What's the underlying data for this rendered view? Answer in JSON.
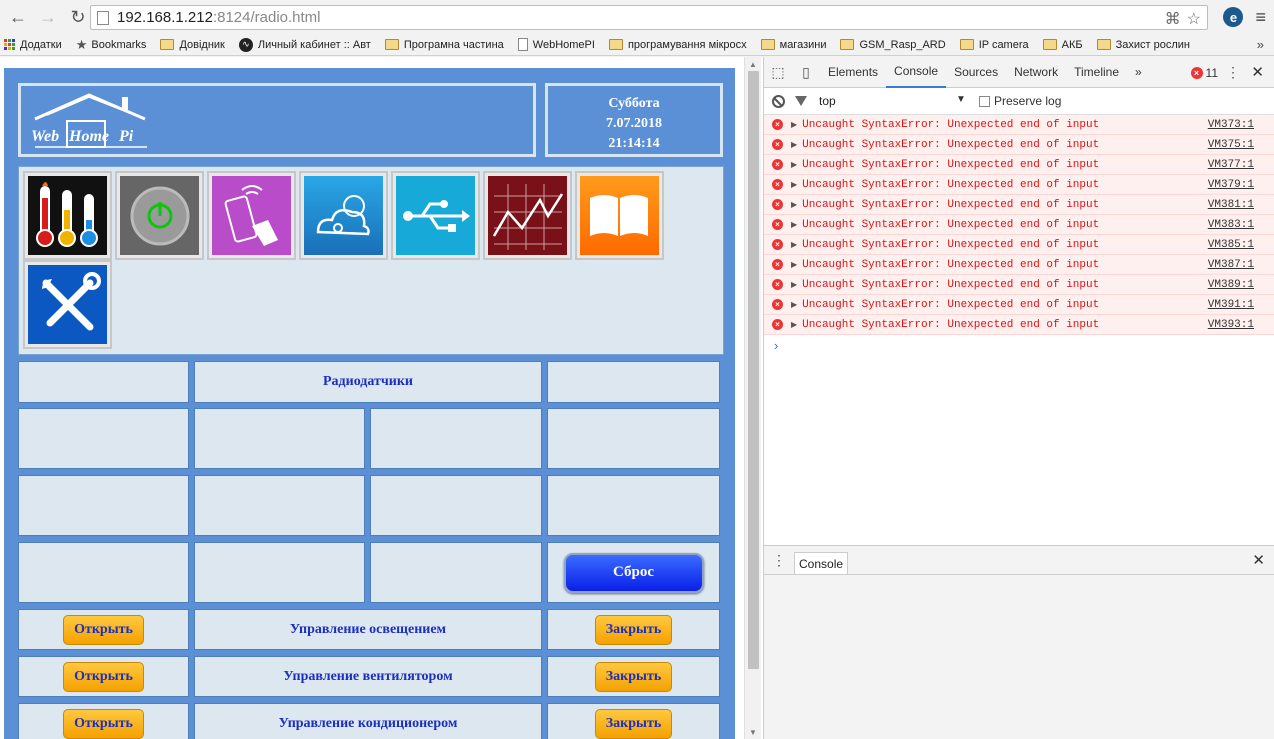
{
  "browser": {
    "url_host": "192.168.1.212",
    "url_rest": ":8124/radio.html",
    "back_glyph": "←",
    "forward_glyph": "→",
    "reload_glyph": "↻"
  },
  "bookmarks": [
    {
      "label": "Додатки",
      "icon": "apps-icon"
    },
    {
      "label": "Bookmarks",
      "icon": "star-icon"
    },
    {
      "label": "Довідник",
      "icon": "folder-icon"
    },
    {
      "label": "Личный кабинет :: Авт",
      "icon": "site-icon"
    },
    {
      "label": "Програмна частина",
      "icon": "folder-icon"
    },
    {
      "label": "WebHomePI",
      "icon": "page-icon"
    },
    {
      "label": "програмування мікросх",
      "icon": "folder-icon"
    },
    {
      "label": "магазини",
      "icon": "folder-icon"
    },
    {
      "label": "GSM_Rasp_ARD",
      "icon": "folder-icon"
    },
    {
      "label": "IP camera",
      "icon": "folder-icon"
    },
    {
      "label": "АКБ",
      "icon": "folder-icon"
    },
    {
      "label": "Захист рослин",
      "icon": "folder-icon"
    }
  ],
  "app": {
    "logo_text": {
      "web": "Web",
      "home": "Home",
      "pi": "Pi"
    },
    "date": {
      "day": "Суббота",
      "date": "7.07.2018",
      "time": "21:14:14"
    },
    "tiles": [
      "thermometers-icon",
      "power-icon",
      "remote-control-icon",
      "weather-icon",
      "usb-icon",
      "chart-icon",
      "book-icon",
      "tools-icon"
    ],
    "section_title": "Радиодатчики",
    "reset_label": "Сброс",
    "controls": [
      {
        "open": "Открыть",
        "label": "Управление освещением",
        "close": "Закрыть"
      },
      {
        "open": "Открыть",
        "label": "Управление вентилятором",
        "close": "Закрыть"
      },
      {
        "open": "Открыть",
        "label": "Управление кондиционером",
        "close": "Закрыть"
      }
    ]
  },
  "devtools": {
    "tabs": [
      "Elements",
      "Console",
      "Sources",
      "Network",
      "Timeline"
    ],
    "active_tab": "Console",
    "more": "»",
    "error_count": "11",
    "context": "top",
    "preserve_log": "Preserve log",
    "messages": [
      {
        "text": "Uncaught SyntaxError: Unexpected end of input",
        "src": "VM373:1"
      },
      {
        "text": "Uncaught SyntaxError: Unexpected end of input",
        "src": "VM375:1"
      },
      {
        "text": "Uncaught SyntaxError: Unexpected end of input",
        "src": "VM377:1"
      },
      {
        "text": "Uncaught SyntaxError: Unexpected end of input",
        "src": "VM379:1"
      },
      {
        "text": "Uncaught SyntaxError: Unexpected end of input",
        "src": "VM381:1"
      },
      {
        "text": "Uncaught SyntaxError: Unexpected end of input",
        "src": "VM383:1"
      },
      {
        "text": "Uncaught SyntaxError: Unexpected end of input",
        "src": "VM385:1"
      },
      {
        "text": "Uncaught SyntaxError: Unexpected end of input",
        "src": "VM387:1"
      },
      {
        "text": "Uncaught SyntaxError: Unexpected end of input",
        "src": "VM389:1"
      },
      {
        "text": "Uncaught SyntaxError: Unexpected end of input",
        "src": "VM391:1"
      },
      {
        "text": "Uncaught SyntaxError: Unexpected end of input",
        "src": "VM393:1"
      }
    ],
    "prompt": "›",
    "drawer_tab": "Console"
  },
  "colors": {
    "accent": "#5b8fd6",
    "error": "#e01010",
    "button_orange": "#f5a100",
    "button_blue": "#0a1fe8"
  }
}
